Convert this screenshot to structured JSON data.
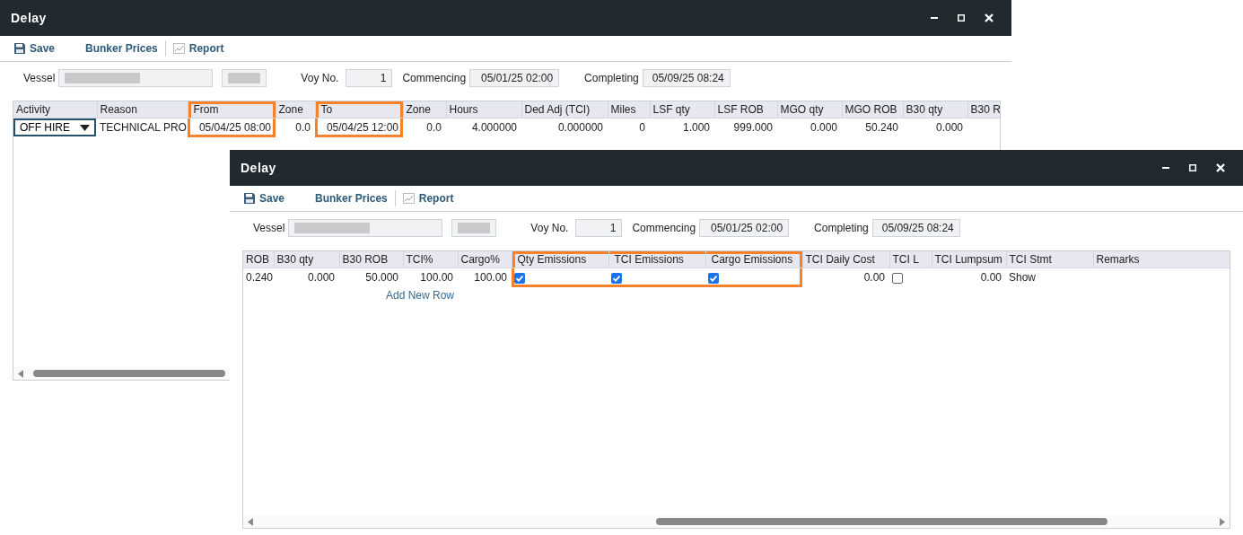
{
  "windows": [
    {
      "title": "Delay",
      "toolbar": [
        {
          "kind": "save",
          "label": "Save"
        },
        {
          "kind": "link",
          "label": "Bunker Prices"
        },
        {
          "kind": "report",
          "label": "Report"
        }
      ],
      "form": {
        "vessel_label": "Vessel",
        "voy_label": "Voy No.",
        "voy_no": "1",
        "commencing_label": "Commencing",
        "commencing": "05/01/25 02:00",
        "completing_label": "Completing",
        "completing": "05/09/25 08:24"
      },
      "grid": {
        "columns": [
          {
            "label": "Activity",
            "highlighted": false
          },
          {
            "label": "Reason",
            "highlighted": false
          },
          {
            "label": "From",
            "highlighted": true
          },
          {
            "label": "Zone",
            "highlighted": false
          },
          {
            "label": "To",
            "highlighted": true
          },
          {
            "label": "Zone",
            "highlighted": false
          },
          {
            "label": "Hours",
            "highlighted": false
          },
          {
            "label": "Ded Adj (TCI)",
            "highlighted": false
          },
          {
            "label": "Miles",
            "highlighted": false
          },
          {
            "label": "LSF qty",
            "highlighted": false
          },
          {
            "label": "LSF ROB",
            "highlighted": false
          },
          {
            "label": "MGO qty",
            "highlighted": false
          },
          {
            "label": "MGO ROB",
            "highlighted": false
          },
          {
            "label": "B30 qty",
            "highlighted": false
          },
          {
            "label": "B30 R",
            "highlighted": false
          }
        ],
        "rows": [
          {
            "cells": [
              {
                "kind": "select",
                "value": "OFF HIRE"
              },
              {
                "kind": "text",
                "value": "TECHNICAL PRO"
              },
              {
                "kind": "number",
                "value": "05/04/25 08:00"
              },
              {
                "kind": "number",
                "value": "0.0"
              },
              {
                "kind": "number",
                "value": "05/04/25 12:00"
              },
              {
                "kind": "number",
                "value": "0.0"
              },
              {
                "kind": "number",
                "value": "4.000000"
              },
              {
                "kind": "number",
                "value": "0.000000"
              },
              {
                "kind": "number",
                "value": "0"
              },
              {
                "kind": "number",
                "value": "1.000"
              },
              {
                "kind": "number",
                "value": "999.000"
              },
              {
                "kind": "number",
                "value": "0.000"
              },
              {
                "kind": "number",
                "value": "50.240"
              },
              {
                "kind": "number",
                "value": "0.000"
              }
            ]
          }
        ]
      }
    },
    {
      "title": "Delay",
      "toolbar": [
        {
          "kind": "save",
          "label": "Save"
        },
        {
          "kind": "link",
          "label": "Bunker Prices"
        },
        {
          "kind": "report",
          "label": "Report"
        }
      ],
      "form": {
        "vessel_label": "Vessel",
        "voy_label": "Voy No.",
        "voy_no": "1",
        "commencing_label": "Commencing",
        "commencing": "05/01/25 02:00",
        "completing_label": "Completing",
        "completing": "05/09/25 08:24"
      },
      "grid": {
        "columns": [
          {
            "label": "ROB",
            "highlighted": false
          },
          {
            "label": "B30 qty",
            "highlighted": false
          },
          {
            "label": "B30 ROB",
            "highlighted": false
          },
          {
            "label": "TCI%",
            "highlighted": false
          },
          {
            "label": "Cargo%",
            "highlighted": false
          },
          {
            "label": "Qty Emissions",
            "highlighted": true
          },
          {
            "label": "TCI Emissions",
            "highlighted": true
          },
          {
            "label": "Cargo Emissions",
            "highlighted": true
          },
          {
            "label": "TCI Daily Cost",
            "highlighted": false
          },
          {
            "label": "TCI L",
            "highlighted": false
          },
          {
            "label": "TCI Lumpsum",
            "highlighted": false
          },
          {
            "label": "TCI Stmt",
            "highlighted": false
          },
          {
            "label": "Remarks",
            "highlighted": false
          }
        ],
        "rows": [
          {
            "cells": [
              {
                "kind": "number",
                "value": "0.240"
              },
              {
                "kind": "number",
                "value": "0.000"
              },
              {
                "kind": "number",
                "value": "50.000"
              },
              {
                "kind": "number",
                "value": "100.00"
              },
              {
                "kind": "number",
                "value": "100.00"
              },
              {
                "kind": "check",
                "checked": true
              },
              {
                "kind": "check",
                "checked": true
              },
              {
                "kind": "check",
                "checked": true
              },
              {
                "kind": "number",
                "value": "0.00"
              },
              {
                "kind": "check",
                "checked": false
              },
              {
                "kind": "number",
                "value": "0.00"
              },
              {
                "kind": "text",
                "value": "Show"
              }
            ]
          }
        ],
        "add_row": "Add New Row"
      }
    }
  ]
}
